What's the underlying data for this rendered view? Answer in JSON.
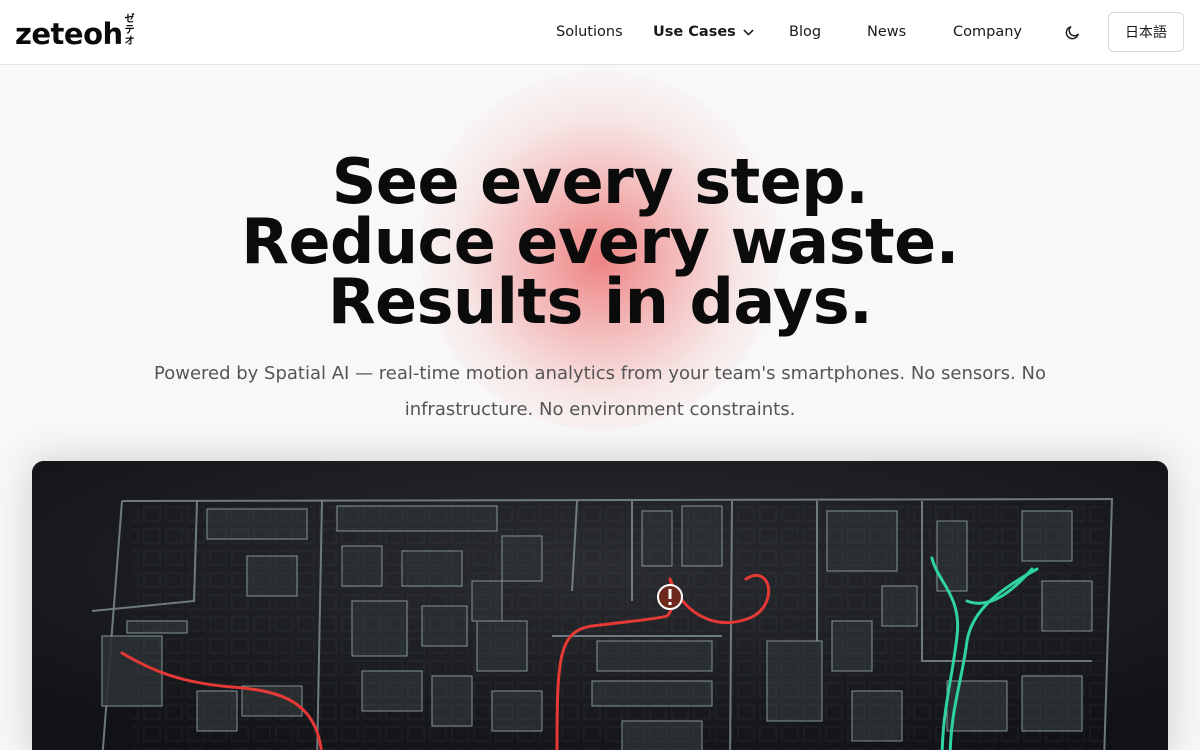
{
  "brand": {
    "name": "zeteoh",
    "kana": [
      "ゼ",
      "テ",
      "オ"
    ]
  },
  "nav": {
    "solutions": "Solutions",
    "use_cases": "Use Cases",
    "blog": "Blog",
    "news": "News",
    "company": "Company",
    "language": "日本語"
  },
  "icons": {
    "theme": "moon-icon",
    "dropdown": "chevron-down-icon",
    "alert": "exclamation-icon"
  },
  "hero": {
    "line1": "See every step.",
    "line2": "Reduce every waste.",
    "line3": "Results in days.",
    "subtitle_line1": "Powered by Spatial AI — real-time motion analytics from your team's smartphones. No sensors. No",
    "subtitle_line2": "infrastructure. No environment constraints."
  },
  "colors": {
    "accent_glow": "#ec6e6e",
    "path_red": "#e53935",
    "path_green": "#2ed3a0",
    "visual_bg": "#121316"
  }
}
